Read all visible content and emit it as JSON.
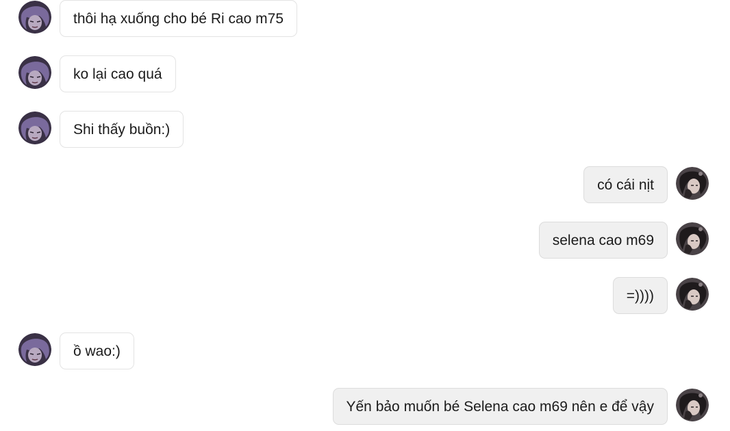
{
  "messages": [
    {
      "sender": "them",
      "avatar": "purple-hair-avatar",
      "text": "thôi hạ xuống cho bé Ri cao m75"
    },
    {
      "sender": "them",
      "avatar": "purple-hair-avatar",
      "text": "ko lại cao quá"
    },
    {
      "sender": "them",
      "avatar": "purple-hair-avatar",
      "text": "Shi thấy buồn:)"
    },
    {
      "sender": "me",
      "avatar": "dark-hair-avatar",
      "text": "có cái nịt"
    },
    {
      "sender": "me",
      "avatar": "dark-hair-avatar",
      "text": "selena cao m69"
    },
    {
      "sender": "me",
      "avatar": "dark-hair-avatar",
      "text": "=))))"
    },
    {
      "sender": "them",
      "avatar": "purple-hair-avatar",
      "text": "ồ wao:)"
    },
    {
      "sender": "me",
      "avatar": "dark-hair-avatar",
      "text": "Yến bảo muốn bé Selena cao m69 nên e để vậy"
    }
  ],
  "colors": {
    "them_bubble_bg": "#ffffff",
    "me_bubble_bg": "#f0f0f0",
    "text": "#1b1b1b"
  }
}
